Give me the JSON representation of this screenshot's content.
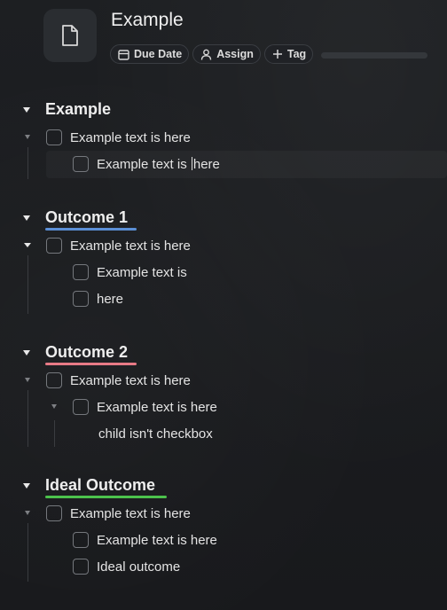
{
  "page": {
    "title": "Example",
    "icon": "document-icon"
  },
  "toolbar": {
    "due_date_label": "Due Date",
    "assign_label": "Assign",
    "tag_label": "Tag",
    "progress": 0
  },
  "colors": {
    "background": "#1b1d20",
    "outcome_1_underline": "#5b8fd6",
    "outcome_2_underline": "#e87a86",
    "ideal_outcome_underline": "#4cc24c"
  },
  "sections": [
    {
      "heading": "Example",
      "items": [
        {
          "text": "Example text is here",
          "checked": false
        },
        {
          "text_before_cursor": "Example text is ",
          "text_after_cursor": "here",
          "checked": false
        }
      ]
    },
    {
      "heading": "Outcome 1",
      "items": [
        {
          "text": "Example text is here",
          "checked": false
        },
        {
          "text": "Example text is",
          "checked": false
        },
        {
          "text": "here",
          "checked": false
        }
      ]
    },
    {
      "heading": "Outcome 2",
      "items": [
        {
          "text": "Example text is here",
          "checked": false
        },
        {
          "text": "Example text is here",
          "checked": false
        },
        {
          "text": "child isn't checkbox"
        }
      ]
    },
    {
      "heading": "Ideal Outcome",
      "items": [
        {
          "text": "Example text is here",
          "checked": false
        },
        {
          "text": "Example text is here",
          "checked": false
        },
        {
          "text": "Ideal outcome",
          "checked": false
        }
      ]
    }
  ]
}
